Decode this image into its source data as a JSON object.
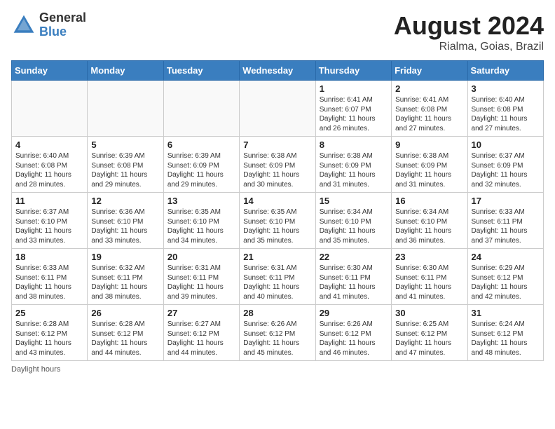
{
  "header": {
    "logo": {
      "general": "General",
      "blue": "Blue"
    },
    "title": "August 2024",
    "location": "Rialma, Goias, Brazil"
  },
  "weekdays": [
    "Sunday",
    "Monday",
    "Tuesday",
    "Wednesday",
    "Thursday",
    "Friday",
    "Saturday"
  ],
  "weeks": [
    [
      {
        "day": "",
        "info": ""
      },
      {
        "day": "",
        "info": ""
      },
      {
        "day": "",
        "info": ""
      },
      {
        "day": "",
        "info": ""
      },
      {
        "day": "1",
        "info": "Sunrise: 6:41 AM\nSunset: 6:07 PM\nDaylight: 11 hours and 26 minutes."
      },
      {
        "day": "2",
        "info": "Sunrise: 6:41 AM\nSunset: 6:08 PM\nDaylight: 11 hours and 27 minutes."
      },
      {
        "day": "3",
        "info": "Sunrise: 6:40 AM\nSunset: 6:08 PM\nDaylight: 11 hours and 27 minutes."
      }
    ],
    [
      {
        "day": "4",
        "info": "Sunrise: 6:40 AM\nSunset: 6:08 PM\nDaylight: 11 hours and 28 minutes."
      },
      {
        "day": "5",
        "info": "Sunrise: 6:39 AM\nSunset: 6:08 PM\nDaylight: 11 hours and 29 minutes."
      },
      {
        "day": "6",
        "info": "Sunrise: 6:39 AM\nSunset: 6:09 PM\nDaylight: 11 hours and 29 minutes."
      },
      {
        "day": "7",
        "info": "Sunrise: 6:38 AM\nSunset: 6:09 PM\nDaylight: 11 hours and 30 minutes."
      },
      {
        "day": "8",
        "info": "Sunrise: 6:38 AM\nSunset: 6:09 PM\nDaylight: 11 hours and 31 minutes."
      },
      {
        "day": "9",
        "info": "Sunrise: 6:38 AM\nSunset: 6:09 PM\nDaylight: 11 hours and 31 minutes."
      },
      {
        "day": "10",
        "info": "Sunrise: 6:37 AM\nSunset: 6:09 PM\nDaylight: 11 hours and 32 minutes."
      }
    ],
    [
      {
        "day": "11",
        "info": "Sunrise: 6:37 AM\nSunset: 6:10 PM\nDaylight: 11 hours and 33 minutes."
      },
      {
        "day": "12",
        "info": "Sunrise: 6:36 AM\nSunset: 6:10 PM\nDaylight: 11 hours and 33 minutes."
      },
      {
        "day": "13",
        "info": "Sunrise: 6:35 AM\nSunset: 6:10 PM\nDaylight: 11 hours and 34 minutes."
      },
      {
        "day": "14",
        "info": "Sunrise: 6:35 AM\nSunset: 6:10 PM\nDaylight: 11 hours and 35 minutes."
      },
      {
        "day": "15",
        "info": "Sunrise: 6:34 AM\nSunset: 6:10 PM\nDaylight: 11 hours and 35 minutes."
      },
      {
        "day": "16",
        "info": "Sunrise: 6:34 AM\nSunset: 6:10 PM\nDaylight: 11 hours and 36 minutes."
      },
      {
        "day": "17",
        "info": "Sunrise: 6:33 AM\nSunset: 6:11 PM\nDaylight: 11 hours and 37 minutes."
      }
    ],
    [
      {
        "day": "18",
        "info": "Sunrise: 6:33 AM\nSunset: 6:11 PM\nDaylight: 11 hours and 38 minutes."
      },
      {
        "day": "19",
        "info": "Sunrise: 6:32 AM\nSunset: 6:11 PM\nDaylight: 11 hours and 38 minutes."
      },
      {
        "day": "20",
        "info": "Sunrise: 6:31 AM\nSunset: 6:11 PM\nDaylight: 11 hours and 39 minutes."
      },
      {
        "day": "21",
        "info": "Sunrise: 6:31 AM\nSunset: 6:11 PM\nDaylight: 11 hours and 40 minutes."
      },
      {
        "day": "22",
        "info": "Sunrise: 6:30 AM\nSunset: 6:11 PM\nDaylight: 11 hours and 41 minutes."
      },
      {
        "day": "23",
        "info": "Sunrise: 6:30 AM\nSunset: 6:11 PM\nDaylight: 11 hours and 41 minutes."
      },
      {
        "day": "24",
        "info": "Sunrise: 6:29 AM\nSunset: 6:12 PM\nDaylight: 11 hours and 42 minutes."
      }
    ],
    [
      {
        "day": "25",
        "info": "Sunrise: 6:28 AM\nSunset: 6:12 PM\nDaylight: 11 hours and 43 minutes."
      },
      {
        "day": "26",
        "info": "Sunrise: 6:28 AM\nSunset: 6:12 PM\nDaylight: 11 hours and 44 minutes."
      },
      {
        "day": "27",
        "info": "Sunrise: 6:27 AM\nSunset: 6:12 PM\nDaylight: 11 hours and 44 minutes."
      },
      {
        "day": "28",
        "info": "Sunrise: 6:26 AM\nSunset: 6:12 PM\nDaylight: 11 hours and 45 minutes."
      },
      {
        "day": "29",
        "info": "Sunrise: 6:26 AM\nSunset: 6:12 PM\nDaylight: 11 hours and 46 minutes."
      },
      {
        "day": "30",
        "info": "Sunrise: 6:25 AM\nSunset: 6:12 PM\nDaylight: 11 hours and 47 minutes."
      },
      {
        "day": "31",
        "info": "Sunrise: 6:24 AM\nSunset: 6:12 PM\nDaylight: 11 hours and 48 minutes."
      }
    ]
  ],
  "footer": {
    "note": "Daylight hours"
  }
}
